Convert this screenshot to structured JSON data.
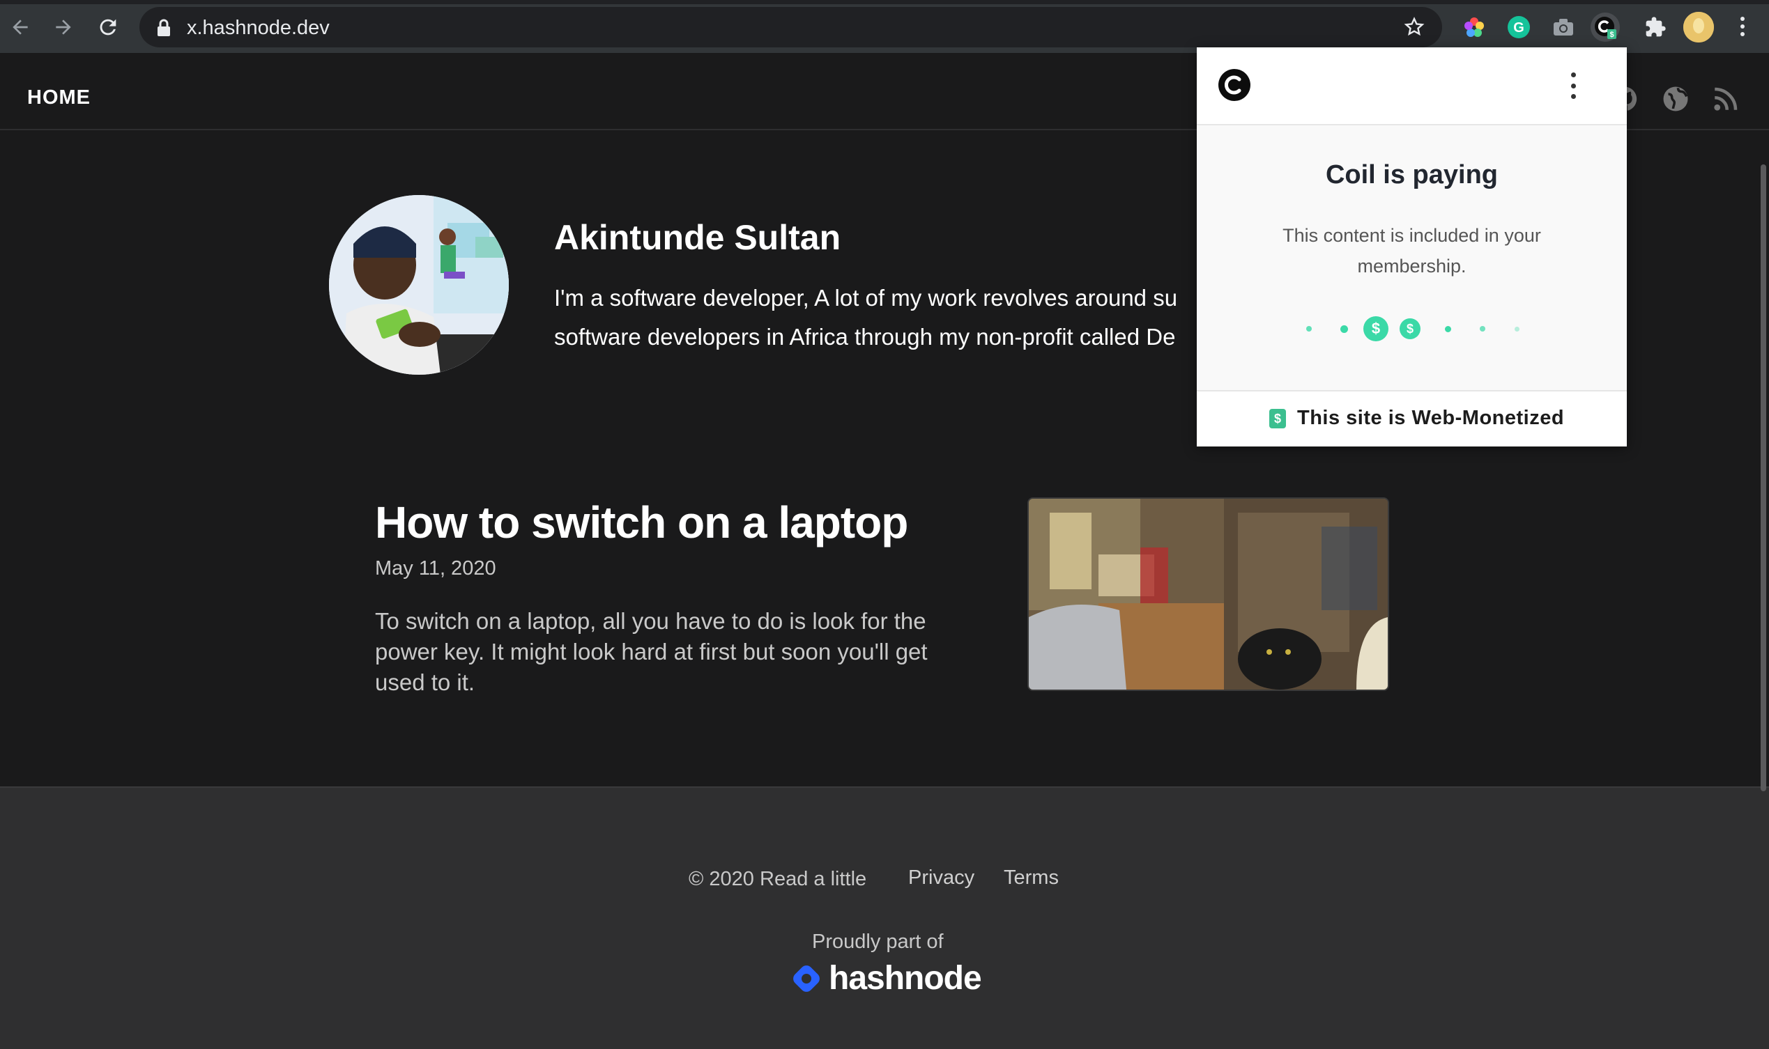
{
  "browser": {
    "url": "x.hashnode.dev"
  },
  "header": {
    "home_label": "HOME"
  },
  "profile": {
    "name": "Akintunde Sultan",
    "bio_line1": "I'm a software developer, A lot of my work revolves around su",
    "bio_line2": "software developers in Africa through my non-profit called De"
  },
  "post": {
    "title": "How to switch on a laptop",
    "date": "May 11, 2020",
    "excerpt": "To switch on a laptop, all you have to do is look for the power key. It might look hard at first but soon you'll get used to it."
  },
  "footer": {
    "copyright": "© 2020 Read a little",
    "privacy": "Privacy",
    "terms": "Terms",
    "proudly": "Proudly part of",
    "brand": "hashnode"
  },
  "coil_popup": {
    "title": "Coil is paying",
    "subtitle": "This content is included in your membership.",
    "footer_text": "This site is Web-Monetized",
    "dollar_symbol": "$"
  },
  "colors": {
    "coil_green": "#3bd9a7",
    "hashnode_blue": "#2962ff",
    "page_bg": "#1a1a1b",
    "footer_bg": "#2f2f30"
  }
}
